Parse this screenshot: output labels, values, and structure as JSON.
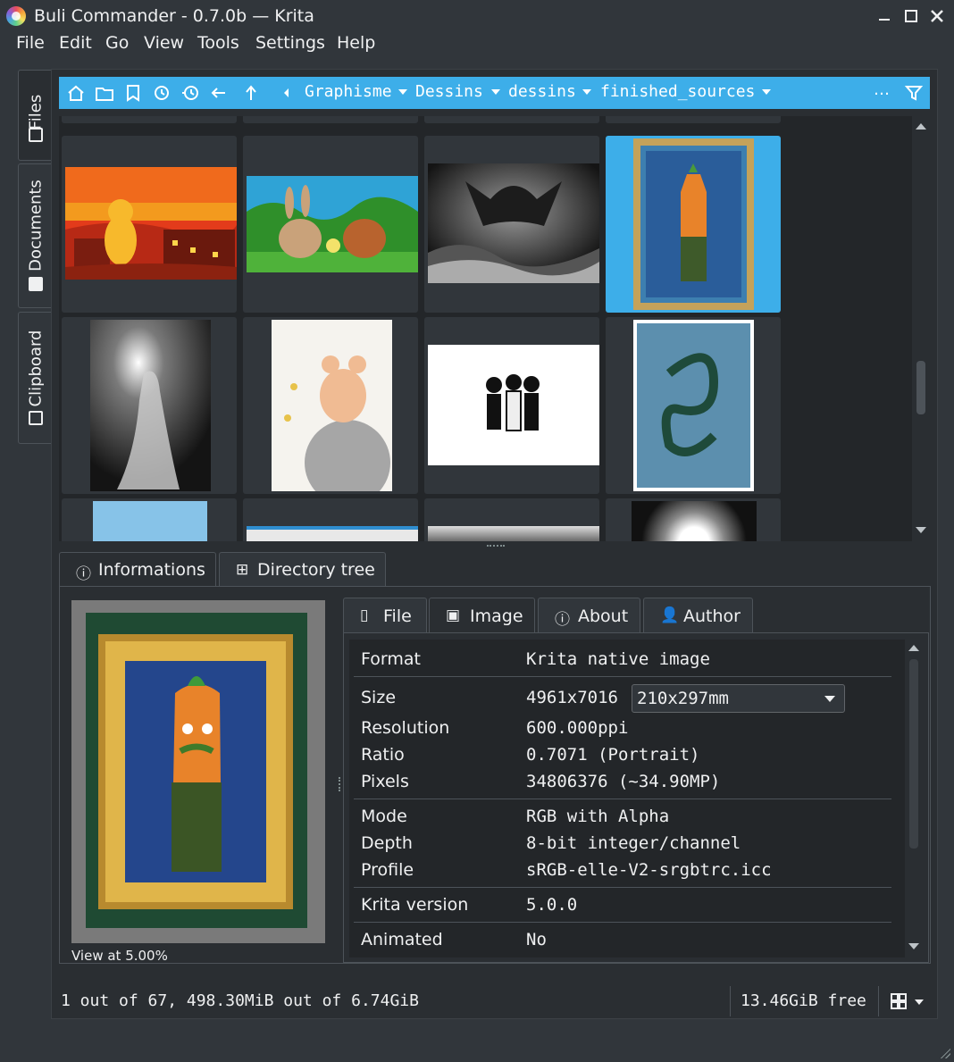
{
  "window": {
    "title": "Buli Commander - 0.7.0b — Krita",
    "controls": {
      "minimize": "–",
      "maximize": "□",
      "close": "✕"
    }
  },
  "menu": [
    "File",
    "Edit",
    "Go",
    "View",
    "Tools",
    "Settings",
    "Help"
  ],
  "side_tabs": [
    "Files",
    "Documents",
    "Clipboard"
  ],
  "pathbar": {
    "crumbs": [
      "Graphisme",
      "Dessins",
      "dessins",
      "finished_sources"
    ],
    "more": "…"
  },
  "bottom_tabs": {
    "informations": "Informations",
    "directory_tree": "Directory tree"
  },
  "preview": {
    "caption": "View at 5.00%"
  },
  "info_tabs": {
    "file": "File",
    "image": "Image",
    "about": "About",
    "author": "Author"
  },
  "info": {
    "format_label": "Format",
    "format_value": "Krita native image",
    "size_label": "Size",
    "size_value": "4961x7016",
    "size_unit": "210x297mm",
    "resolution_label": "Resolution",
    "resolution_value": "600.000ppi",
    "ratio_label": "Ratio",
    "ratio_value": "0.7071 (Portrait)",
    "pixels_label": "Pixels",
    "pixels_value": "34806376 (~34.90MP)",
    "mode_label": "Mode",
    "mode_value": "RGB with Alpha",
    "depth_label": "Depth",
    "depth_value": "8-bit integer/channel",
    "profile_label": "Profile",
    "profile_value": "sRGB-elle-V2-srgbtrc.icc",
    "krita_label": "Krita version",
    "krita_value": "5.0.0",
    "animated_label": "Animated",
    "animated_value": "No"
  },
  "status": {
    "selection": "1 out of 67, 498.30MiB out of 6.74GiB",
    "free": "13.46GiB free"
  },
  "colors": {
    "accent": "#3daee9",
    "background": "#31363b",
    "panel": "#2a2e32"
  }
}
